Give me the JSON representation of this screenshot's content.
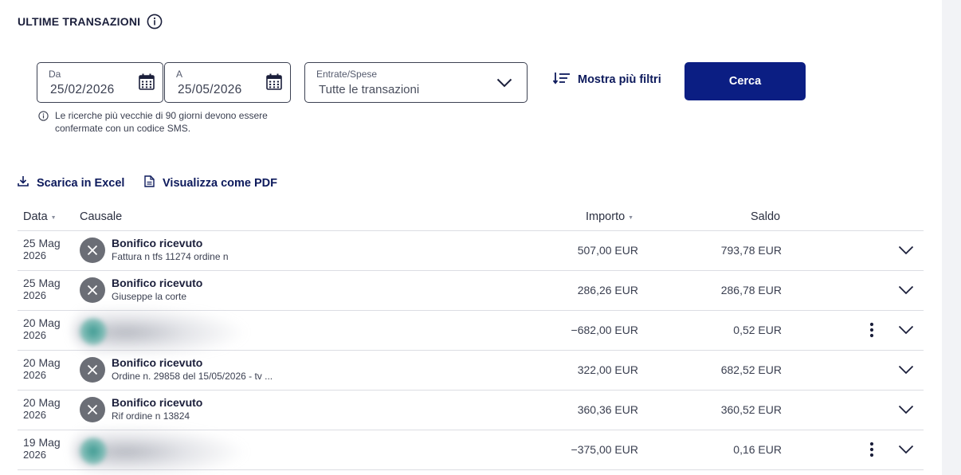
{
  "header": {
    "title": "ULTIME TRANSAZIONI",
    "info_icon": "info-circle-icon"
  },
  "filters": {
    "from": {
      "label": "Da",
      "value": "25/02/2026",
      "icon": "calendar-icon"
    },
    "to": {
      "label": "A",
      "value": "25/05/2026",
      "icon": "calendar-icon"
    },
    "type": {
      "label": "Entrate/Spese",
      "value": "Tutte le transazioni",
      "icon": "chevron-down-icon"
    },
    "more_filters_label": "Mostra più filtri",
    "search_label": "Cerca",
    "note": "Le ricerche più vecchie di 90 giorni devono essere confermate con un codice SMS."
  },
  "actions": {
    "excel_label": "Scarica in Excel",
    "pdf_label": "Visualizza come PDF"
  },
  "table": {
    "columns": {
      "date": "Data",
      "description": "Causale",
      "amount": "Importo",
      "balance": "Saldo"
    },
    "rows": [
      {
        "date": "25 Mag",
        "year": "2026",
        "title": "Bonifico ricevuto",
        "subtitle": "Fattura n tfs 11274 ordine n",
        "amount": "507,00 EUR",
        "balance": "793,78 EUR",
        "redacted": false,
        "menu": false
      },
      {
        "date": "25 Mag",
        "year": "2026",
        "title": "Bonifico ricevuto",
        "subtitle": "Giuseppe la corte",
        "amount": "286,26 EUR",
        "balance": "286,78 EUR",
        "redacted": false,
        "menu": false
      },
      {
        "date": "20 Mag",
        "year": "2026",
        "title": "",
        "subtitle": "",
        "amount": "−682,00 EUR",
        "balance": "0,52 EUR",
        "redacted": true,
        "menu": true
      },
      {
        "date": "20 Mag",
        "year": "2026",
        "title": "Bonifico ricevuto",
        "subtitle": "Ordine n. 29858 del 15/05/2026 - tv ...",
        "amount": "322,00 EUR",
        "balance": "682,52 EUR",
        "redacted": false,
        "menu": false
      },
      {
        "date": "20 Mag",
        "year": "2026",
        "title": "Bonifico ricevuto",
        "subtitle": "Rif ordine n 13824",
        "amount": "360,36 EUR",
        "balance": "360,52 EUR",
        "redacted": false,
        "menu": false
      },
      {
        "date": "19 Mag",
        "year": "2026",
        "title": "",
        "subtitle": "",
        "amount": "−375,00 EUR",
        "balance": "0,16 EUR",
        "redacted": true,
        "menu": true
      }
    ]
  },
  "colors": {
    "primary": "#0b1e83",
    "link": "#0d1a5c",
    "border": "#3c4152",
    "status_icon": "#6b6e76"
  }
}
